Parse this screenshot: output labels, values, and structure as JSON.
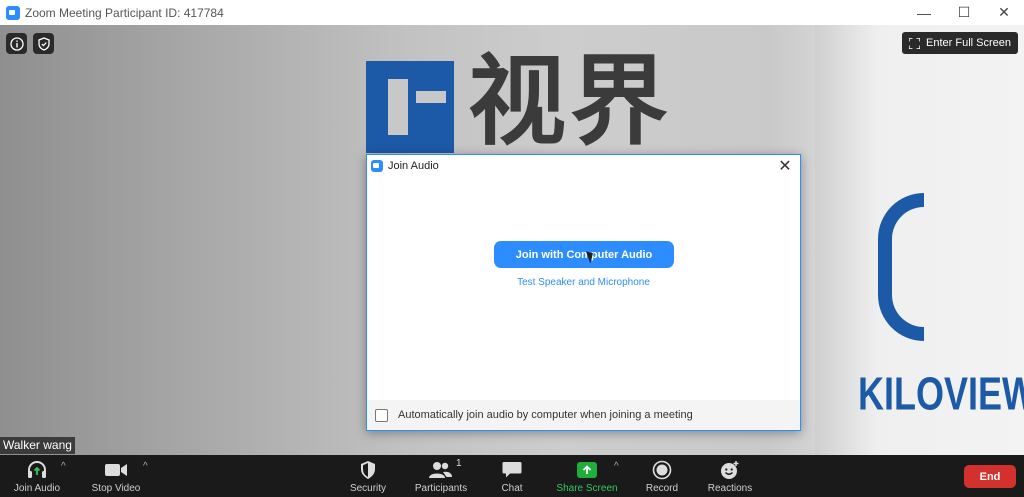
{
  "window": {
    "title": "Zoom Meeting Participant ID: 417784",
    "minimize": "—",
    "maximize": "☐",
    "close": "✕"
  },
  "video": {
    "info_icon": "i",
    "fullscreen_label": "Enter Full Screen",
    "participant_name": "Walker wang",
    "background_text_cn": "视界",
    "background_brand": "KILOVIEW"
  },
  "dialog": {
    "title": "Join Audio",
    "close": "✕",
    "join_button": "Join with Computer Audio",
    "test_link": "Test Speaker and Microphone",
    "auto_join_label": "Automatically join audio by computer when joining a meeting",
    "auto_join_checked": false
  },
  "toolbar": {
    "join_audio": "Join Audio",
    "stop_video": "Stop Video",
    "security": "Security",
    "participants": "Participants",
    "participants_count": "1",
    "chat": "Chat",
    "share_screen": "Share Screen",
    "record": "Record",
    "reactions": "Reactions",
    "end": "End",
    "caret": "^"
  },
  "colors": {
    "accent": "#2d8cff",
    "share_green": "#1fae3a",
    "end_red": "#d2312d",
    "toolbar_bg": "#1a1a1a"
  }
}
